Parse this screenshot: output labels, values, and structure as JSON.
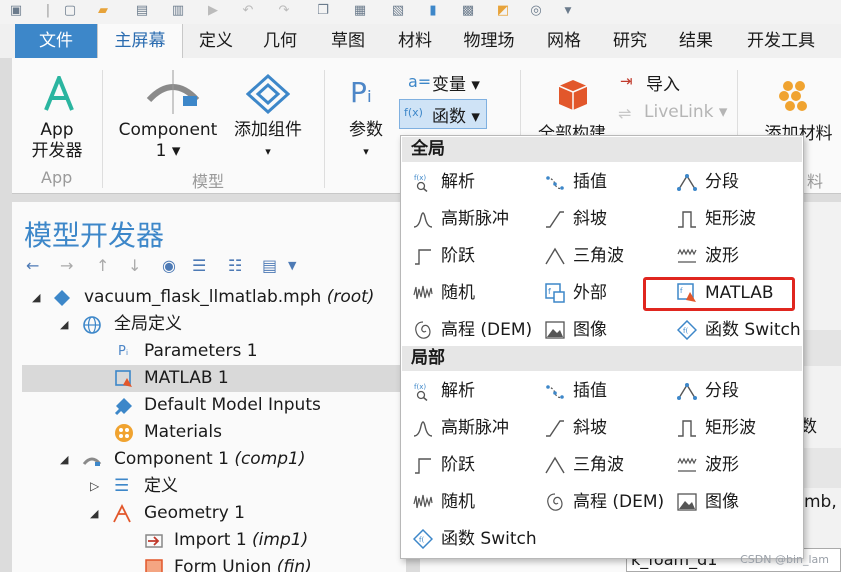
{
  "tabs": {
    "file": "文件",
    "home": "主屏幕",
    "define": "定义",
    "geometry": "几何",
    "sketch": "草图",
    "materials": "材料",
    "physics": "物理场",
    "mesh": "网格",
    "study": "研究",
    "results": "结果",
    "developer": "开发工具"
  },
  "ribbon": {
    "app_builder": {
      "line1": "App",
      "line2": "开发器"
    },
    "app_group": "App",
    "component": {
      "line1": "Component",
      "line2": "1 ▾"
    },
    "add_component": {
      "line1": "添加组件",
      "line2": "▾"
    },
    "model_group": "模型",
    "parameters": {
      "line1": "参数",
      "line2": "▾"
    },
    "variables": "变量 ▾",
    "functions": "函数 ▾",
    "build_all": "全部构建",
    "import": "导入",
    "livelink": "LiveLink ▾",
    "add_material": "添加材料",
    "partial_right": "料"
  },
  "model_builder": {
    "title": "模型开发器",
    "tree": [
      {
        "label": "vacuum_flask_llmatlab.mph",
        "tag": "(root)"
      },
      {
        "label": "全局定义",
        "tag": ""
      },
      {
        "label": "Parameters 1",
        "tag": ""
      },
      {
        "label": "MATLAB 1",
        "tag": ""
      },
      {
        "label": "Default Model Inputs",
        "tag": ""
      },
      {
        "label": "Materials",
        "tag": ""
      },
      {
        "label": "Component 1",
        "tag": "(comp1)"
      },
      {
        "label": "定义",
        "tag": ""
      },
      {
        "label": "Geometry 1",
        "tag": ""
      },
      {
        "label": "Import 1",
        "tag": "(imp1)"
      },
      {
        "label": "Form Union",
        "tag": "(fin)"
      }
    ]
  },
  "right_panel": {
    "fragment1": "数",
    "fragment2": "mb,",
    "fragment3": "k_foam_d1"
  },
  "dropdown": {
    "global_header": "全局",
    "local_header": "局部",
    "global_items": [
      "解析",
      "插值",
      "分段",
      "高斯脉冲",
      "斜坡",
      "矩形波",
      "阶跃",
      "三角波",
      "波形",
      "随机",
      "外部",
      "MATLAB",
      "高程 (DEM)",
      "图像",
      "函数 Switch"
    ],
    "local_items": [
      "解析",
      "插值",
      "分段",
      "高斯脉冲",
      "斜坡",
      "矩形波",
      "阶跃",
      "三角波",
      "波形",
      "随机",
      "高程 (DEM)",
      "图像",
      "函数 Switch"
    ]
  },
  "watermark": "CSDN @bin_lam",
  "colors": {
    "accent": "#3d87c9",
    "highlight": "#e0261f",
    "selection": "#d9d9d9"
  }
}
